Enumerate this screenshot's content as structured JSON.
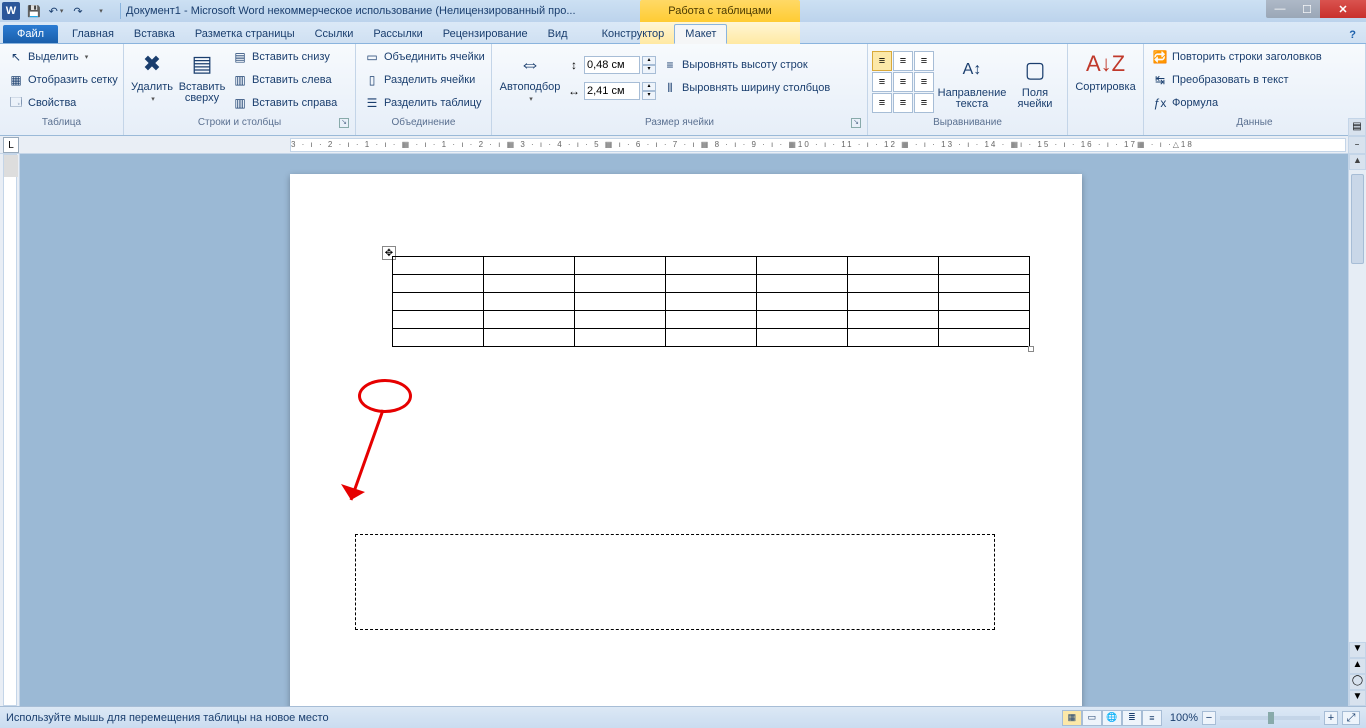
{
  "app": {
    "title": "Документ1 - Microsoft Word некоммерческое использование (Нелицензированный про...",
    "context_title": "Работа с таблицами"
  },
  "tabs": {
    "file": "Файл",
    "list": [
      "Главная",
      "Вставка",
      "Разметка страницы",
      "Ссылки",
      "Рассылки",
      "Рецензирование",
      "Вид"
    ],
    "context": [
      "Конструктор",
      "Макет"
    ],
    "active": "Макет"
  },
  "ribbon": {
    "table_group": "Таблица",
    "table": {
      "select": "Выделить",
      "gridlines": "Отобразить сетку",
      "properties": "Свойства"
    },
    "rows_cols_group": "Строки и столбцы",
    "delete": "Удалить",
    "insert_above": "Вставить сверху",
    "insert_below": "Вставить снизу",
    "insert_left": "Вставить слева",
    "insert_right": "Вставить справа",
    "merge_group": "Объединение",
    "merge": "Объединить ячейки",
    "split_cells": "Разделить ячейки",
    "split_table": "Разделить таблицу",
    "autofit": "Автоподбор",
    "cell_size_group": "Размер ячейки",
    "row_h": "0,48 см",
    "col_w": "2,41 см",
    "dist_rows": "Выровнять высоту строк",
    "dist_cols": "Выровнять ширину столбцов",
    "align_group": "Выравнивание",
    "text_dir": "Направление текста",
    "cell_margins": "Поля ячейки",
    "sort": "Сортировка",
    "data_group": "Данные",
    "repeat_header": "Повторить строки заголовков",
    "convert": "Преобразовать в текст",
    "formula": "Формула"
  },
  "ruler": "3 · ı · 2 · ı · 1 · ı · ▦ · ı · 1 · ı · 2 · ı ▦ 3 · ı · 4 · ı · 5 ▦ ı · 6 · ı · 7 · ı ▦ 8 · ı · 9 · ı · ▦10 · ı · 11 · ı · 12 ▦ · ı · 13 · ı · 14 · ▦ı · 15 · ı · 16 · ı · 17▦ · ı ·△18",
  "doc_table": {
    "rows": 5,
    "cols": 7
  },
  "statusbar": {
    "hint": "Используйте мышь для перемещения таблицы на новое место",
    "zoom": "100%"
  }
}
